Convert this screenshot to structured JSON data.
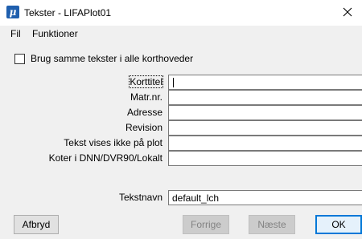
{
  "window": {
    "title": "Tekster - LIFAPlot01",
    "icon": "app-icon"
  },
  "menu": [
    "Fil",
    "Funktioner"
  ],
  "checkbox": {
    "label": "Brug samme tekster i alle korthoveder",
    "checked": false
  },
  "fields": [
    {
      "label": "Korttitel",
      "value": ""
    },
    {
      "label": "Matr.nr.",
      "value": ""
    },
    {
      "label": "Adresse",
      "value": ""
    },
    {
      "label": "Revision",
      "value": ""
    },
    {
      "label": "Tekst vises ikke på plot",
      "value": ""
    },
    {
      "label": "Koter i DNN/DVR90/Lokalt",
      "value": ""
    }
  ],
  "tekstnavn": {
    "label": "Tekstnavn",
    "value": "default_lch"
  },
  "buttons": {
    "cancel": "Afbryd",
    "previous": "Forrige",
    "next": "Næste",
    "ok": "OK"
  },
  "colors": {
    "accent": "#0078d7",
    "icon_bg": "#1f5fae"
  }
}
